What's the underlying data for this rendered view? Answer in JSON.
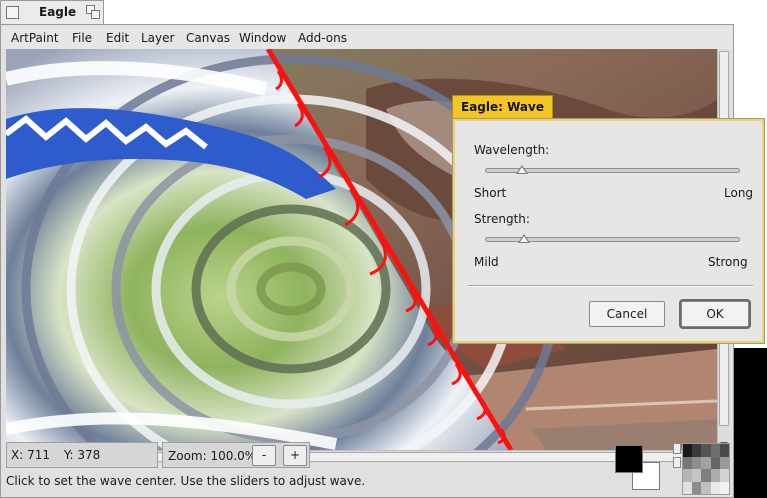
{
  "window": {
    "title": "Eagle"
  },
  "menu": [
    "ArtPaint",
    "File",
    "Edit",
    "Layer",
    "Canvas",
    "Window",
    "Add-ons"
  ],
  "status": {
    "x_label": "X: 711",
    "y_label": "Y: 378",
    "zoom_label": "Zoom: 100.0%",
    "zoom_out": "-",
    "zoom_in": "+",
    "hint": "Click to set the wave center. Use the sliders to adjust wave."
  },
  "colors": {
    "foreground": "#000000",
    "background": "#ffffff",
    "dialog_accent": "#f3c623"
  },
  "palette": [
    "#1a1a1a",
    "#3a3a3a",
    "#555555",
    "#6e6e6e",
    "#4a4a4a",
    "#777777",
    "#8e8e8e",
    "#a2a2a2",
    "#666666",
    "#999999",
    "#b4b4b4",
    "#c4c4c4",
    "#7f7f7f",
    "#adadad",
    "#d2d2d2",
    "#e0e0e0",
    "#8c8c8c",
    "#bfbfbf",
    "#e8e8e8",
    "#f2f2f2"
  ],
  "dialog": {
    "title": "Eagle: Wave",
    "wavelength": {
      "label": "Wavelength:",
      "min_label": "Short",
      "max_label": "Long",
      "value": 0.14
    },
    "strength": {
      "label": "Strength:",
      "min_label": "Mild",
      "max_label": "Strong",
      "value": 0.15
    },
    "cancel": "Cancel",
    "ok": "OK"
  }
}
